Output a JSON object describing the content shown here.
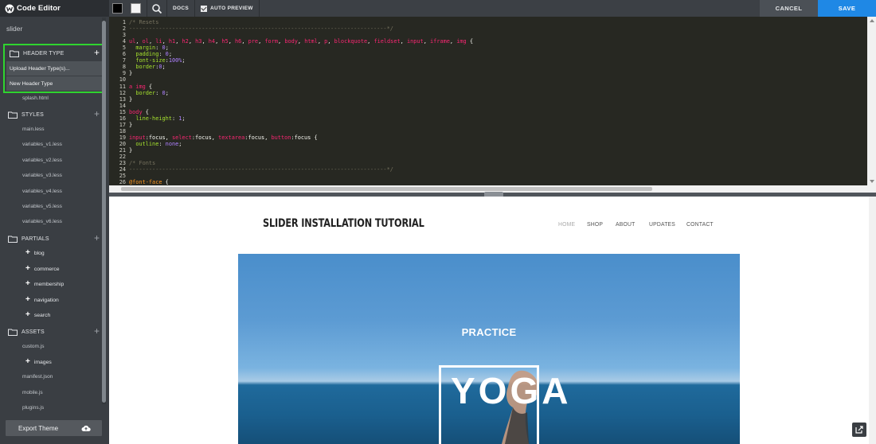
{
  "app": {
    "title": "Code Editor",
    "theme_name": "slider"
  },
  "sidebar": {
    "header_type": {
      "label": "HEADER TYPE",
      "menu": [
        "Upload Header Type(s)...",
        "New Header Type"
      ]
    },
    "header_files": [
      "splash.html"
    ],
    "styles": {
      "label": "STYLES",
      "files": [
        "main.less",
        "variables_v1.less",
        "variables_v2.less",
        "variables_v3.less",
        "variables_v4.less",
        "variables_v5.less",
        "variables_v6.less"
      ]
    },
    "partials": {
      "label": "PARTIALS",
      "folders": [
        "blog",
        "commerce",
        "membership",
        "navigation",
        "search"
      ]
    },
    "assets": {
      "label": "ASSETS",
      "file_custom": "custom.js",
      "folder_images": "images",
      "files_after": [
        "manifest.json",
        "mobile.js",
        "plugins.js"
      ]
    },
    "export_label": "Export Theme"
  },
  "toolbar": {
    "docs": "DOCS",
    "auto_preview": "AUTO PREVIEW",
    "cancel": "CANCEL",
    "save": "SAVE"
  },
  "editor": {
    "lines": [
      "/* Resets",
      "------------------------------------------------------------------------------*/",
      "",
      "ul, ol, li, h1, h2, h3, h4, h5, h6, pre, form, body, html, p, blockquote, fieldset, input, iframe, img {",
      "  margin: 0;",
      "  padding: 0;",
      "  font-size:100%;",
      "  border:0;",
      "}",
      "",
      "a img {",
      "  border: 0;",
      "}",
      "",
      "body {",
      "  line-height: 1;",
      "}",
      "",
      "input:focus, select:focus, textarea:focus, button:focus {",
      "  outline: none;",
      "}",
      "",
      "/* Fonts",
      "------------------------------------------------------------------------------*/",
      "",
      "@font-face {",
      ""
    ]
  },
  "preview": {
    "site_title": "SLIDER INSTALLATION TUTORIAL",
    "nav": [
      "HOME",
      "SHOP",
      "ABOUT",
      "UPDATES",
      "CONTACT"
    ],
    "nav_active": "HOME",
    "hero_kicker": "PRACTICE",
    "hero_word": "YOGA"
  },
  "colors": {
    "accent_save": "#1f88e5",
    "highlight_border": "#2fd42f",
    "sidebar_bg": "#3a3e43",
    "editor_bg": "#272822"
  }
}
